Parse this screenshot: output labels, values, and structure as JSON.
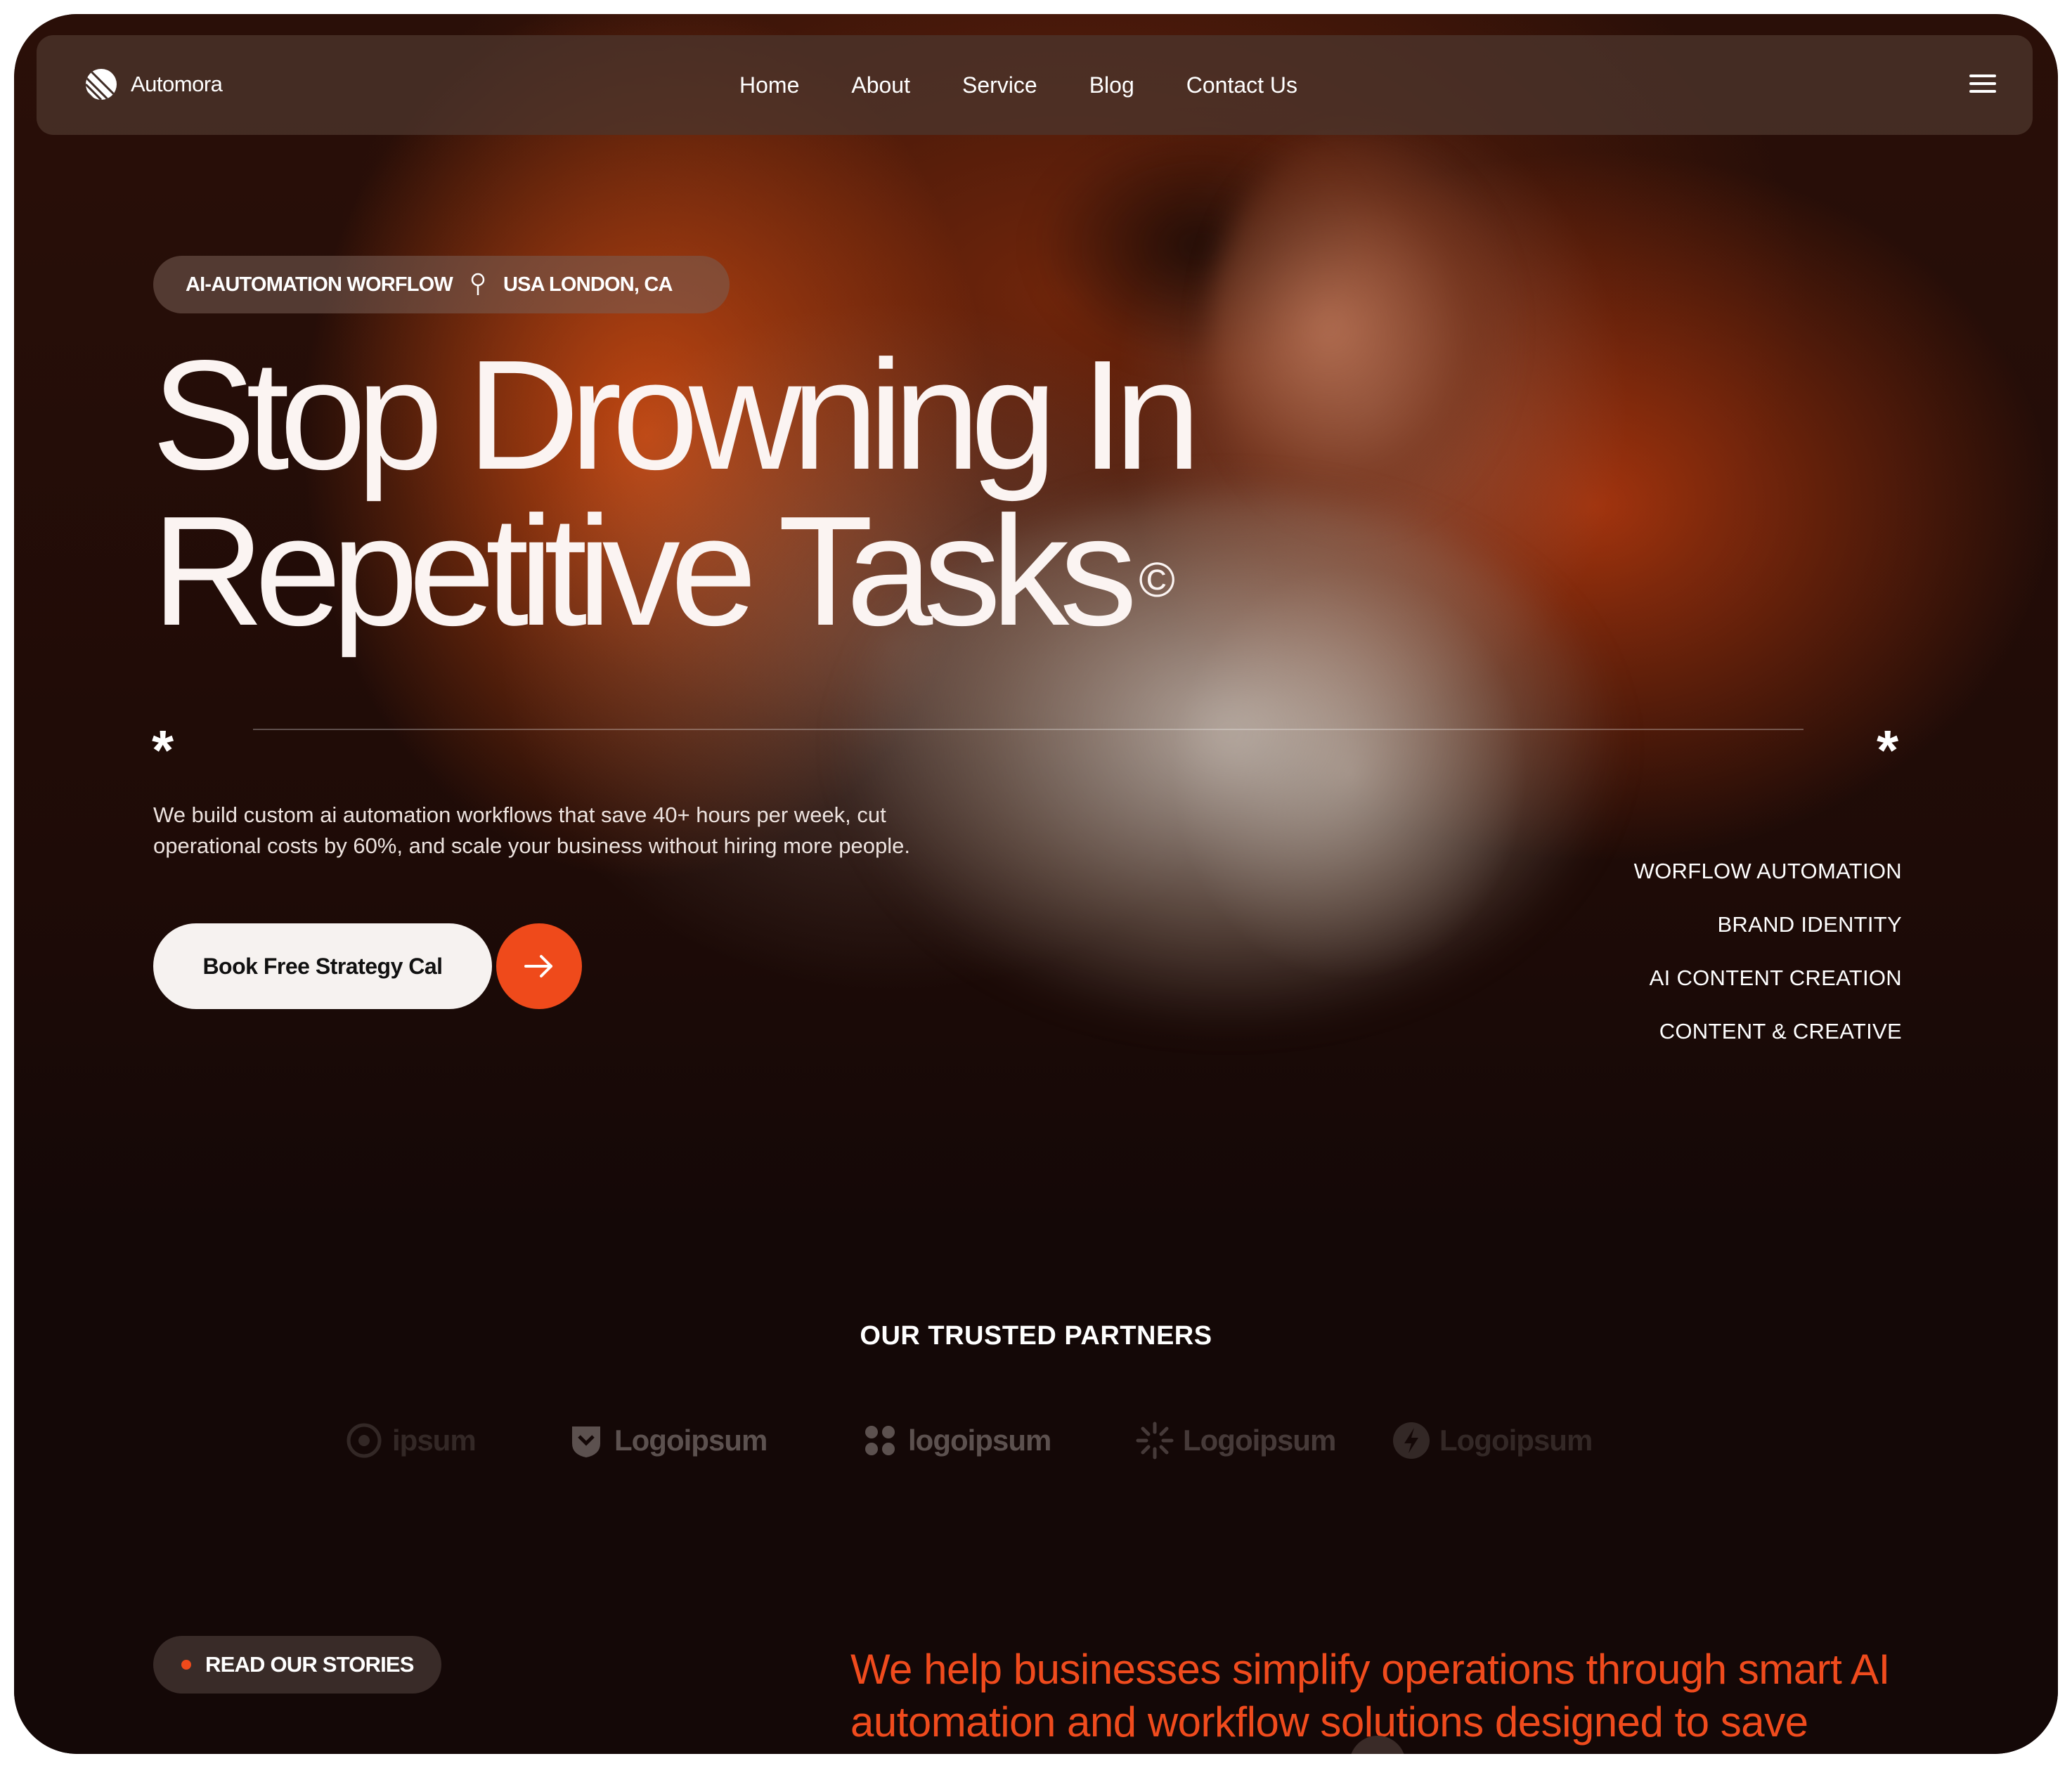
{
  "nav": {
    "brand": "Automora",
    "items": [
      "Home",
      "About",
      "Service",
      "Blog",
      "Contact Us"
    ],
    "menu_icon": "hamburger-icon"
  },
  "hero": {
    "tag_left": "AI-AUTOMATION WORFLOW",
    "tag_icon": "location-pin-icon",
    "tag_right": "USA LONDON, CA",
    "headline_line1": "Stop Drowning In",
    "headline_line2": "Repetitive Tasks",
    "headline_mark": "©",
    "star_glyph": "*",
    "description": "We build custom ai automation workflows that save 40+ hours per week, cut operational costs by 60%, and scale your business without hiring more people.",
    "cta_label": "Book Free Strategy Cal",
    "cta_icon": "arrow-right-icon",
    "services": [
      "WORFLOW AUTOMATION",
      "BRAND IDENTITY",
      "AI CONTENT CREATION",
      "CONTENT & CREATIVE"
    ]
  },
  "partners": {
    "title": "OUR TRUSTED PARTNERS",
    "logos": [
      "ipsum",
      "Logoipsum",
      "logoipsum",
      "Logoipsum",
      "Logoipsum"
    ]
  },
  "stories": {
    "label": "READ OUR STORIES",
    "mission": "We help businesses simplify operations through smart AI automation and workflow solutions designed to save"
  },
  "colors": {
    "accent": "#ef4a1b",
    "background": "#140807",
    "mission_text": "#f04b1d"
  }
}
